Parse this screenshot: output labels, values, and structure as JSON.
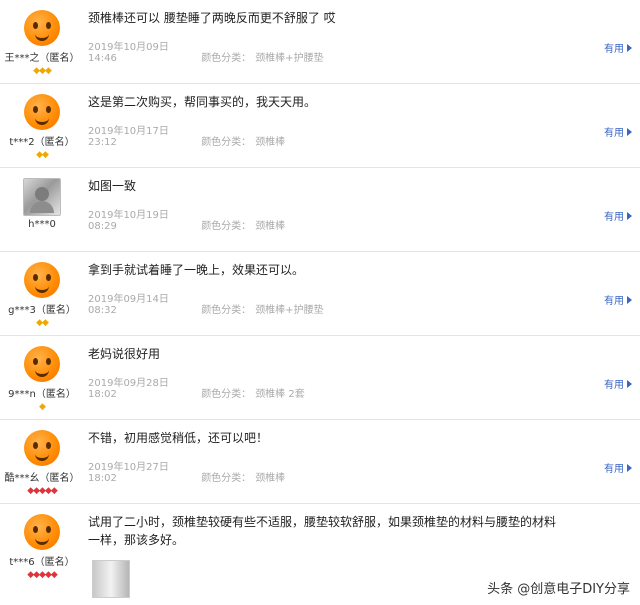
{
  "reviews": [
    {
      "user": "王***之（匿名）",
      "badges": "◆◆◆",
      "text": "颈椎棒还可以 腰垫睡了两晚反而更不舒服了 哎",
      "date": "2019年10月09日 14:46",
      "sku_label": "颜色分类：",
      "sku_value": "颈椎棒+护腰垫",
      "useful": "有用"
    },
    {
      "user": "t***2（匿名）",
      "badges": "◆◆",
      "text": "这是第二次购买，帮同事买的，我天天用。",
      "date": "2019年10月17日 23:12",
      "sku_label": "颜色分类：",
      "sku_value": "颈椎棒",
      "useful": "有用"
    },
    {
      "user": "h***0",
      "badges": "",
      "text": "如图一致",
      "date": "2019年10月19日 08:29",
      "sku_label": "颜色分类：",
      "sku_value": "颈椎棒",
      "useful": "有用"
    },
    {
      "user": "g***3（匿名）",
      "badges": "◆◆",
      "text": "拿到手就试着睡了一晚上，效果还可以。",
      "date": "2019年09月14日 08:32",
      "sku_label": "颜色分类：",
      "sku_value": "颈椎棒+护腰垫",
      "useful": "有用"
    },
    {
      "user": "9***n（匿名）",
      "badges": "◆",
      "text": "老妈说很好用",
      "date": "2019年09月28日 18:02",
      "sku_label": "颜色分类：",
      "sku_value": "颈椎棒 2套",
      "useful": "有用"
    },
    {
      "user": "酷***幺（匿名）",
      "badges": "◆◆◆◆◆",
      "text": "不错，初用感觉稍低，还可以吧！",
      "date": "2019年10月27日 18:02",
      "sku_label": "颜色分类：",
      "sku_value": "颈椎棒",
      "useful": "有用"
    },
    {
      "user": "t***6（匿名）",
      "badges": "◆◆◆◆◆",
      "text": "试用了二小时，颈椎垫较硬有些不适服，腰垫较软舒服，如果颈椎垫的材料与腰垫的材料一样，那该多好。",
      "date": "",
      "sku_label": "",
      "sku_value": "",
      "useful": ""
    }
  ],
  "watermark": "头条 @创意电子DIY分享",
  "colors": {
    "link": "#3a66c4",
    "meta": "#aaaaaa",
    "badge_gold": "#f0a800",
    "badge_red": "#e2323c"
  },
  "icons": {
    "useful": "triangle-right-icon",
    "avatar": "orange-cartoon-avatar"
  }
}
